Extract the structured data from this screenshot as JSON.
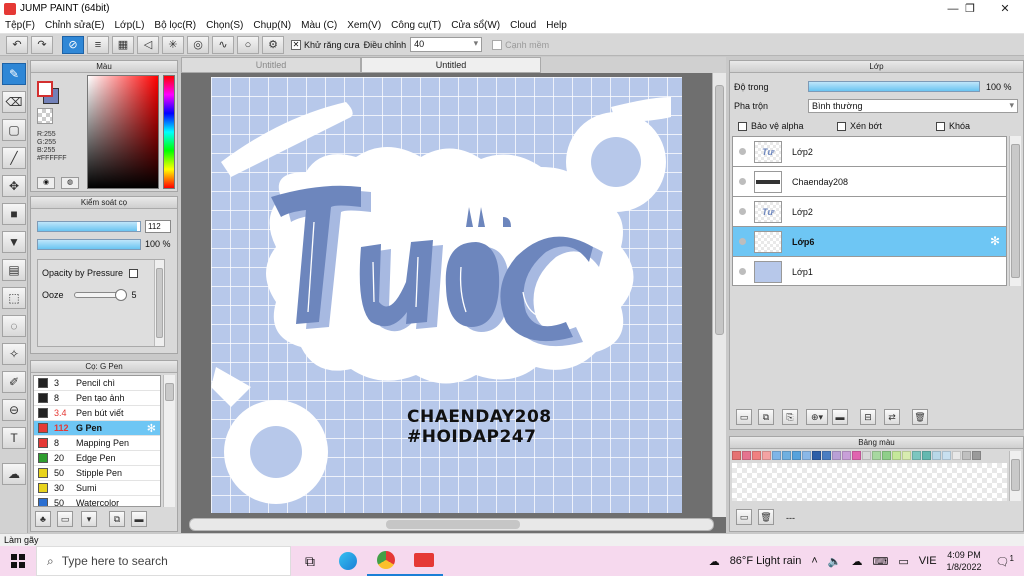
{
  "window": {
    "title": "JUMP PAINT (64bit)",
    "min": "—",
    "restore": "❐",
    "close": "✕"
  },
  "menu": [
    "Tệp(F)",
    "Chỉnh sửa(E)",
    "Lớp(L)",
    "Bộ lọc(R)",
    "Chọn(S)",
    "Chụp(N)",
    "Màu (C)",
    "Xem(V)",
    "Công cụ(T)",
    "Cửa sổ(W)",
    "Cloud",
    "Help"
  ],
  "toolbar": {
    "antialias_label": "Khử răng cưa",
    "adjust_label": "Điều chỉnh",
    "adjust_value": "40",
    "edge_label": "Cạnh mềm"
  },
  "color_panel": {
    "title": "Màu",
    "r": "R:255",
    "g": "G:255",
    "b": "B:255",
    "hex": "#FFFFFF"
  },
  "brush_control": {
    "title": "Kiểm soát cọ",
    "size": "112",
    "size_fraction": 0.97,
    "opacity": "100 %",
    "opacity_fraction": 1.0,
    "opacity_pressure_label": "Opacity by Pressure",
    "ooze_label": "Ooze",
    "ooze_value": "5"
  },
  "brush_list": {
    "title": "Cọ: G Pen",
    "items": [
      {
        "size": "3",
        "name": "Pencil chì",
        "color": "#222222"
      },
      {
        "size": "8",
        "name": "Pen tạo ảnh",
        "color": "#222222"
      },
      {
        "size": "3.4",
        "name": "Pen bút viết",
        "color": "#222222"
      },
      {
        "size": "112",
        "name": "G Pen",
        "color": "#e53935"
      },
      {
        "size": "8",
        "name": "Mapping Pen",
        "color": "#e53935"
      },
      {
        "size": "20",
        "name": "Edge Pen",
        "color": "#2e9d2e"
      },
      {
        "size": "50",
        "name": "Stipple Pen",
        "color": "#e8d31c"
      },
      {
        "size": "30",
        "name": "Sumi",
        "color": "#e8d31c"
      },
      {
        "size": "50",
        "name": "Watercolor",
        "color": "#2b6fd1"
      }
    ]
  },
  "canvas": {
    "tabs": [
      "Untitled",
      "Untitled"
    ],
    "art_text_line1": "CHAENDAY208",
    "art_text_line2": "#HOIDAP247"
  },
  "layer_panel": {
    "title": "Lớp",
    "opacity_label": "Độ trong",
    "opacity_value": "100 %",
    "opacity_fraction": 1.0,
    "blend_label": "Pha trộn",
    "blend_value": "Bình thường",
    "protect_alpha": "Bảo vệ alpha",
    "clipping": "Xén bớt",
    "lock": "Khóa",
    "layers": [
      {
        "name": "Lớp2",
        "thumb": "Tư"
      },
      {
        "name": "Chaenday208",
        "thumb": ""
      },
      {
        "name": "Lớp2",
        "thumb": "Tư"
      },
      {
        "name": "Lớp6",
        "thumb": ""
      },
      {
        "name": "Lớp1",
        "thumb": ""
      }
    ]
  },
  "palette_panel": {
    "title": "Bảng màu",
    "colors": [
      "#e57373",
      "#e5738f",
      "#f08080",
      "#f4a3a3",
      "#7fb5e8",
      "#6fb0e0",
      "#56a2dc",
      "#8ab8e8",
      "#2d5fa8",
      "#4a7ec2",
      "#b9a0d6",
      "#c8a0d8",
      "#e064b0",
      "#d8d8d8",
      "#a7d8a0",
      "#8fcf8a",
      "#c5e89a",
      "#d8ecb0",
      "#7cc6c0",
      "#64b8b0",
      "#b8d8e8",
      "#c8e0f0",
      "#e8e8e8",
      "#c0c0c0",
      "#9a9a9a"
    ],
    "extra": "---"
  },
  "status": {
    "text": "Làm gãy"
  },
  "taskbar": {
    "search_placeholder": "Type here to search",
    "weather": "86°F  Light rain",
    "lang": "VIE",
    "time": "4:09 PM",
    "date": "1/8/2022",
    "notif": "1"
  }
}
